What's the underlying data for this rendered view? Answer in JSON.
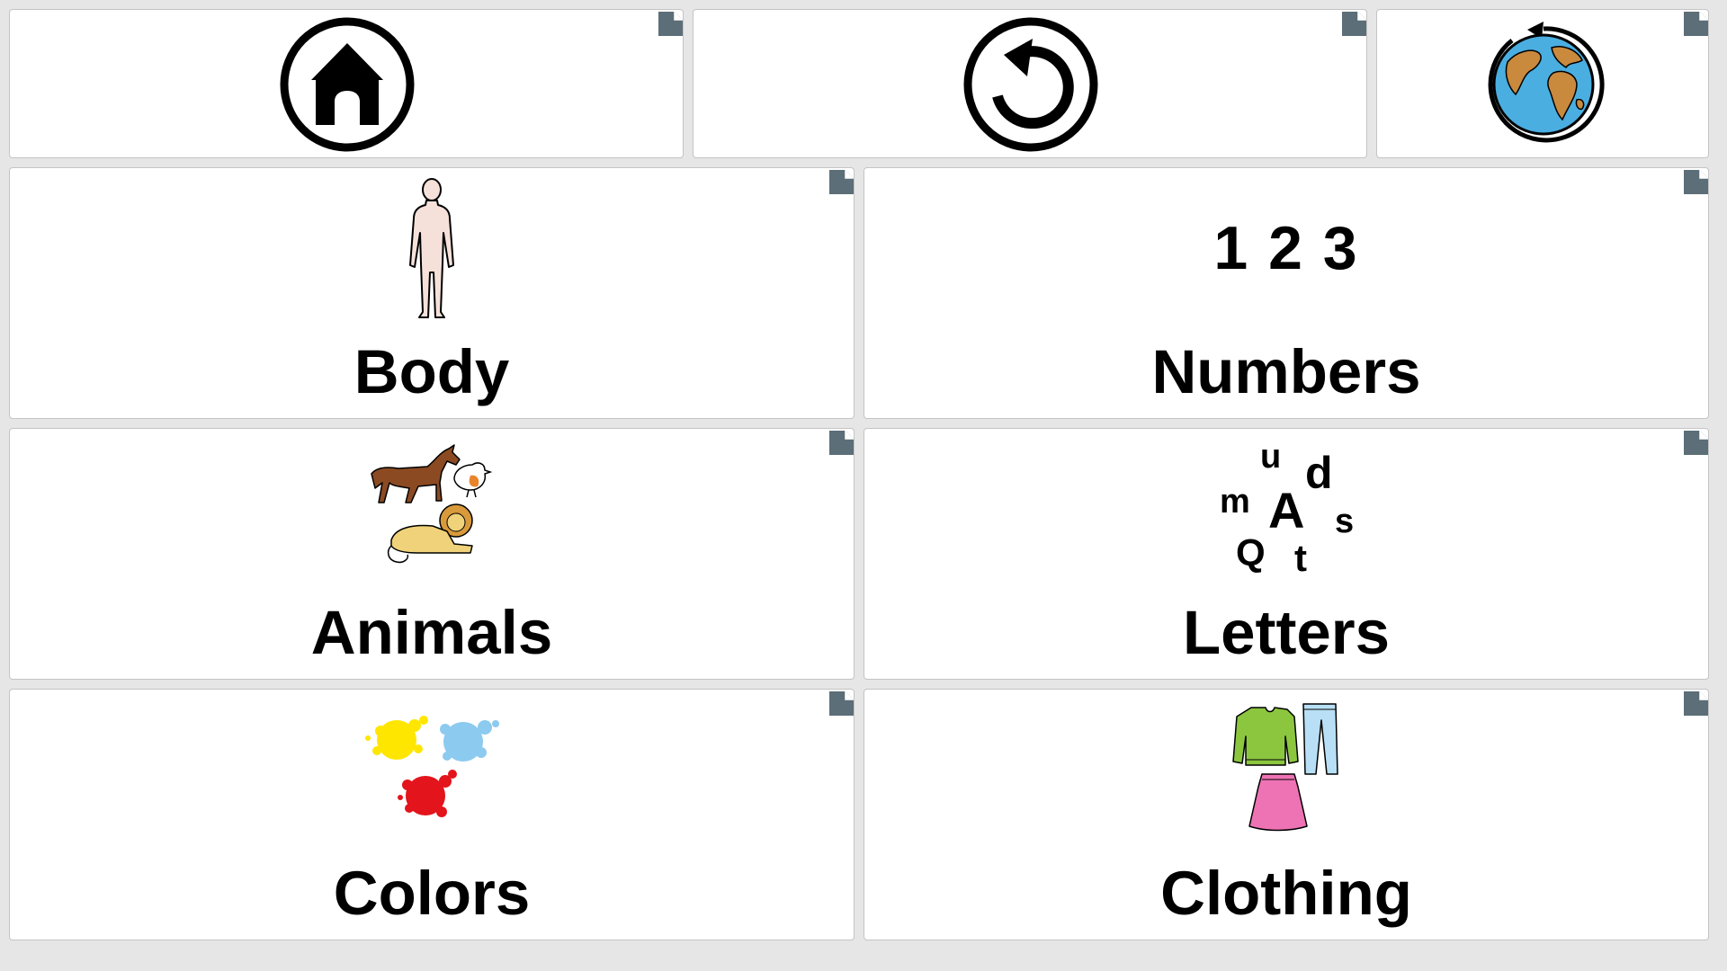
{
  "toolbar": {
    "home_icon": "home-icon",
    "back_icon": "undo-icon",
    "language_icon": "globe-icon"
  },
  "colors": {
    "background": "#e6e6e6",
    "tile": "#ffffff",
    "corner_marker": "#5c6e78"
  },
  "categories": [
    {
      "label": "Body",
      "icon": "body-icon"
    },
    {
      "label": "Numbers",
      "icon": "numbers-icon",
      "icon_text": "1 2 3"
    },
    {
      "label": "Animals",
      "icon": "animals-icon"
    },
    {
      "label": "Letters",
      "icon": "letters-icon",
      "icon_letters": [
        "u",
        "d",
        "m",
        "A",
        "s",
        "Q",
        "t"
      ]
    },
    {
      "label": "Colors",
      "icon": "colors-icon"
    },
    {
      "label": "Clothing",
      "icon": "clothing-icon"
    }
  ]
}
